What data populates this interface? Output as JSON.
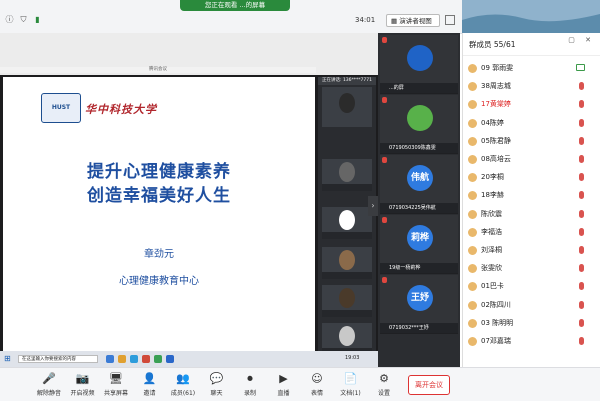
{
  "top": {
    "share_status": "您正在观看 ...的屏幕",
    "timer": "34:01",
    "view_label": "演讲者视图"
  },
  "share": {
    "window_title": "腾讯会议",
    "slide": {
      "logo_text": "华中科技大学",
      "title_line1": "提升心理健康素养",
      "title_line2": "创造幸福美好人生",
      "speaker": "章劲元",
      "org": "心理健康教育中心"
    },
    "mini_strip_header": "正在讲话: 136****7771",
    "mini_labels": [
      "",
      "",
      "",
      "",
      "",
      ""
    ],
    "inner_search_placeholder": "在这里输入你要搜索的内容",
    "inner_clock": "19:03"
  },
  "tiles": [
    {
      "label": "...的屏",
      "avatar_text": "",
      "color": "#1f63c6"
    },
    {
      "label": "0719050309陈鑫雯",
      "avatar_text": "",
      "color": "#58b14a"
    },
    {
      "label": "0719034225吴伟航",
      "avatar_text": "伟航",
      "color": "#2f7be0"
    },
    {
      "label": "19级一杨莉桦",
      "avatar_text": "莉桦",
      "color": "#2f7be0"
    },
    {
      "label": "0719032***王妤",
      "avatar_text": "王妤",
      "color": "#2f7be0"
    }
  ],
  "panel": {
    "title": "群成员 55/61",
    "members": [
      {
        "name": "09 郭雨雯",
        "red": false,
        "icon": "camera"
      },
      {
        "name": "38周志城",
        "red": false,
        "icon": "mic-off"
      },
      {
        "name": "17黄棠婷",
        "red": true,
        "icon": "mic-off"
      },
      {
        "name": "04陈婷",
        "red": false,
        "icon": "mic-off"
      },
      {
        "name": "05陈君静",
        "red": false,
        "icon": "mic-off"
      },
      {
        "name": "08高培云",
        "red": false,
        "icon": "mic-off"
      },
      {
        "name": "20李桐",
        "red": false,
        "icon": "mic-off"
      },
      {
        "name": "18李赫",
        "red": false,
        "icon": "mic-off"
      },
      {
        "name": "陈欣震",
        "red": false,
        "icon": "mic-off"
      },
      {
        "name": "李福浩",
        "red": false,
        "icon": "mic-off"
      },
      {
        "name": "刘泽桐",
        "red": false,
        "icon": "mic-off"
      },
      {
        "name": "张雯欣",
        "red": false,
        "icon": "mic-off"
      },
      {
        "name": "01巴卡",
        "red": false,
        "icon": "mic-off"
      },
      {
        "name": "02陈四川",
        "red": false,
        "icon": "mic-off"
      },
      {
        "name": "03 陈明明",
        "red": false,
        "icon": "mic-off"
      },
      {
        "name": "07邓嘉瑞",
        "red": false,
        "icon": "mic-off"
      }
    ]
  },
  "bottom": {
    "items": [
      {
        "label": "解除静音",
        "icon": "🎤"
      },
      {
        "label": "开启视频",
        "icon": "📷"
      },
      {
        "label": "共享屏幕",
        "icon": "🖥"
      },
      {
        "label": "邀请",
        "icon": "👤"
      },
      {
        "label": "成员(61)",
        "icon": "👥"
      },
      {
        "label": "聊天",
        "icon": "💬"
      },
      {
        "label": "录制",
        "icon": "⏺"
      },
      {
        "label": "直播",
        "icon": "▶"
      },
      {
        "label": "表情",
        "icon": "☺"
      },
      {
        "label": "文档(1)",
        "icon": "📄"
      },
      {
        "label": "设置",
        "icon": "⚙"
      }
    ],
    "leave_label": "离开会议"
  }
}
